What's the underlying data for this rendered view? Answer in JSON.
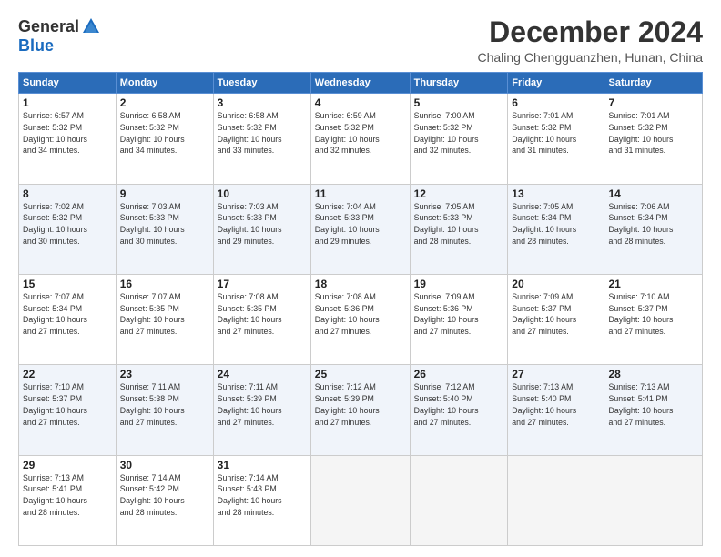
{
  "logo": {
    "general": "General",
    "blue": "Blue"
  },
  "title": "December 2024",
  "location": "Chaling Chengguanzhen, Hunan, China",
  "days_header": [
    "Sunday",
    "Monday",
    "Tuesday",
    "Wednesday",
    "Thursday",
    "Friday",
    "Saturday"
  ],
  "weeks": [
    [
      {
        "day": "1",
        "info": "Sunrise: 6:57 AM\nSunset: 5:32 PM\nDaylight: 10 hours\nand 34 minutes."
      },
      {
        "day": "2",
        "info": "Sunrise: 6:58 AM\nSunset: 5:32 PM\nDaylight: 10 hours\nand 34 minutes."
      },
      {
        "day": "3",
        "info": "Sunrise: 6:58 AM\nSunset: 5:32 PM\nDaylight: 10 hours\nand 33 minutes."
      },
      {
        "day": "4",
        "info": "Sunrise: 6:59 AM\nSunset: 5:32 PM\nDaylight: 10 hours\nand 32 minutes."
      },
      {
        "day": "5",
        "info": "Sunrise: 7:00 AM\nSunset: 5:32 PM\nDaylight: 10 hours\nand 32 minutes."
      },
      {
        "day": "6",
        "info": "Sunrise: 7:01 AM\nSunset: 5:32 PM\nDaylight: 10 hours\nand 31 minutes."
      },
      {
        "day": "7",
        "info": "Sunrise: 7:01 AM\nSunset: 5:32 PM\nDaylight: 10 hours\nand 31 minutes."
      }
    ],
    [
      {
        "day": "8",
        "info": "Sunrise: 7:02 AM\nSunset: 5:32 PM\nDaylight: 10 hours\nand 30 minutes."
      },
      {
        "day": "9",
        "info": "Sunrise: 7:03 AM\nSunset: 5:33 PM\nDaylight: 10 hours\nand 30 minutes."
      },
      {
        "day": "10",
        "info": "Sunrise: 7:03 AM\nSunset: 5:33 PM\nDaylight: 10 hours\nand 29 minutes."
      },
      {
        "day": "11",
        "info": "Sunrise: 7:04 AM\nSunset: 5:33 PM\nDaylight: 10 hours\nand 29 minutes."
      },
      {
        "day": "12",
        "info": "Sunrise: 7:05 AM\nSunset: 5:33 PM\nDaylight: 10 hours\nand 28 minutes."
      },
      {
        "day": "13",
        "info": "Sunrise: 7:05 AM\nSunset: 5:34 PM\nDaylight: 10 hours\nand 28 minutes."
      },
      {
        "day": "14",
        "info": "Sunrise: 7:06 AM\nSunset: 5:34 PM\nDaylight: 10 hours\nand 28 minutes."
      }
    ],
    [
      {
        "day": "15",
        "info": "Sunrise: 7:07 AM\nSunset: 5:34 PM\nDaylight: 10 hours\nand 27 minutes."
      },
      {
        "day": "16",
        "info": "Sunrise: 7:07 AM\nSunset: 5:35 PM\nDaylight: 10 hours\nand 27 minutes."
      },
      {
        "day": "17",
        "info": "Sunrise: 7:08 AM\nSunset: 5:35 PM\nDaylight: 10 hours\nand 27 minutes."
      },
      {
        "day": "18",
        "info": "Sunrise: 7:08 AM\nSunset: 5:36 PM\nDaylight: 10 hours\nand 27 minutes."
      },
      {
        "day": "19",
        "info": "Sunrise: 7:09 AM\nSunset: 5:36 PM\nDaylight: 10 hours\nand 27 minutes."
      },
      {
        "day": "20",
        "info": "Sunrise: 7:09 AM\nSunset: 5:37 PM\nDaylight: 10 hours\nand 27 minutes."
      },
      {
        "day": "21",
        "info": "Sunrise: 7:10 AM\nSunset: 5:37 PM\nDaylight: 10 hours\nand 27 minutes."
      }
    ],
    [
      {
        "day": "22",
        "info": "Sunrise: 7:10 AM\nSunset: 5:37 PM\nDaylight: 10 hours\nand 27 minutes."
      },
      {
        "day": "23",
        "info": "Sunrise: 7:11 AM\nSunset: 5:38 PM\nDaylight: 10 hours\nand 27 minutes."
      },
      {
        "day": "24",
        "info": "Sunrise: 7:11 AM\nSunset: 5:39 PM\nDaylight: 10 hours\nand 27 minutes."
      },
      {
        "day": "25",
        "info": "Sunrise: 7:12 AM\nSunset: 5:39 PM\nDaylight: 10 hours\nand 27 minutes."
      },
      {
        "day": "26",
        "info": "Sunrise: 7:12 AM\nSunset: 5:40 PM\nDaylight: 10 hours\nand 27 minutes."
      },
      {
        "day": "27",
        "info": "Sunrise: 7:13 AM\nSunset: 5:40 PM\nDaylight: 10 hours\nand 27 minutes."
      },
      {
        "day": "28",
        "info": "Sunrise: 7:13 AM\nSunset: 5:41 PM\nDaylight: 10 hours\nand 27 minutes."
      }
    ],
    [
      {
        "day": "29",
        "info": "Sunrise: 7:13 AM\nSunset: 5:41 PM\nDaylight: 10 hours\nand 28 minutes."
      },
      {
        "day": "30",
        "info": "Sunrise: 7:14 AM\nSunset: 5:42 PM\nDaylight: 10 hours\nand 28 minutes."
      },
      {
        "day": "31",
        "info": "Sunrise: 7:14 AM\nSunset: 5:43 PM\nDaylight: 10 hours\nand 28 minutes."
      },
      {
        "day": "",
        "info": ""
      },
      {
        "day": "",
        "info": ""
      },
      {
        "day": "",
        "info": ""
      },
      {
        "day": "",
        "info": ""
      }
    ]
  ]
}
